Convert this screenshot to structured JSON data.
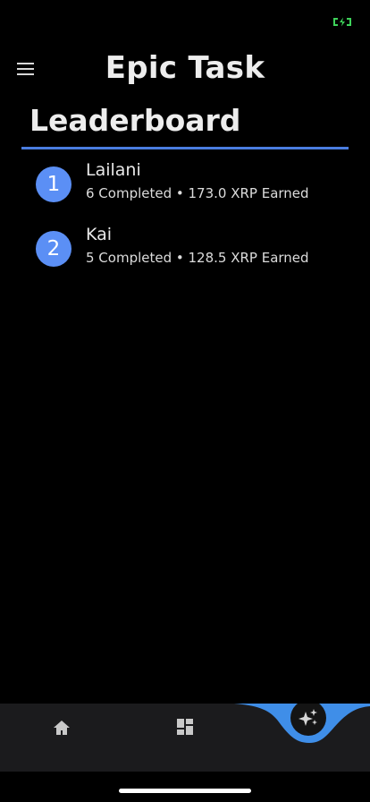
{
  "status_bar": {
    "icon": "battery-charging-icon",
    "icon_color": "#3ed25a"
  },
  "header": {
    "menu_icon": "hamburger-menu-icon",
    "title": "Epic Task"
  },
  "section": {
    "title": "Leaderboard",
    "accent_color": "#4a7de0"
  },
  "leaderboard": [
    {
      "rank": "1",
      "name": "Lailani",
      "stats": "6 Completed • 173.0 XRP Earned"
    },
    {
      "rank": "2",
      "name": "Kai",
      "stats": "5 Completed • 128.5 XRP Earned"
    }
  ],
  "bottom_nav": {
    "items": [
      {
        "icon": "home-icon"
      },
      {
        "icon": "dashboard-icon"
      },
      {
        "icon": "sparkle-icon",
        "active": true
      }
    ],
    "active_color": "#3f8ee8"
  },
  "colors": {
    "background": "#000000",
    "badge": "#5b8ff5",
    "nav_background": "#1b1b1d"
  }
}
